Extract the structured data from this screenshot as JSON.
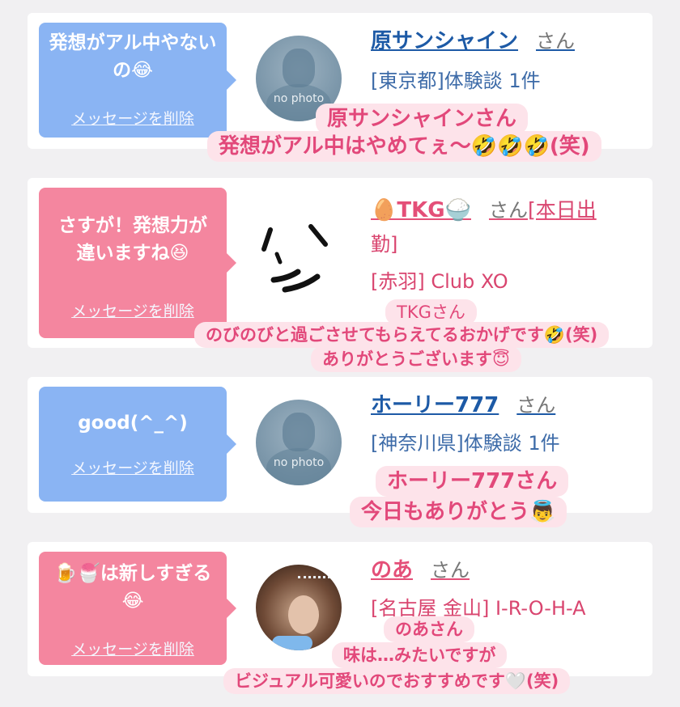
{
  "delete_label": "メッセージを削除",
  "san": "さん",
  "no_photo": "no photo",
  "colors": {
    "blue_bubble": "#8ab4f3",
    "pink_bubble": "#f4869f",
    "caption_bg": "#fde3ea",
    "caption_text": "#e2487a"
  },
  "cards": [
    {
      "message": "発想がアル中やないの😂",
      "name": "原サンシャイン",
      "info": "[東京都]体験談 1件",
      "avatar": "no-photo-avatar",
      "caption": [
        "原サンシャインさん",
        "発想がアル中はやめてぇ〜🤣🤣🤣(笑)"
      ]
    },
    {
      "message": "さすが！発想力が違いますね😆",
      "name": "🥚TKG🍚",
      "name_suffix": "[本日出",
      "name_line2": "勤]",
      "info": "[赤羽] Club XO",
      "avatar": "drawn-face-avatar",
      "caption": [
        "TKGさん",
        "のびのびと過ごさせてもらえてるおかげです🤣(笑)",
        "ありがとうございます😇"
      ]
    },
    {
      "message": "good(^_^)",
      "name": "ホーリー777",
      "info": "[神奈川県]体験談 1件",
      "avatar": "no-photo-avatar",
      "caption": [
        "ホーリー777さん",
        "今日もありがとう👼"
      ]
    },
    {
      "message": "🍺🍧は新しすぎる😂",
      "name": "のあ",
      "info": "[名古屋 金山] I-R-O-H-A",
      "avatar": "photo-avatar",
      "caption": [
        "のあさん",
        "味は…みたいですが",
        "ビジュアル可愛いのでおすすめです🤍(笑)"
      ]
    }
  ]
}
